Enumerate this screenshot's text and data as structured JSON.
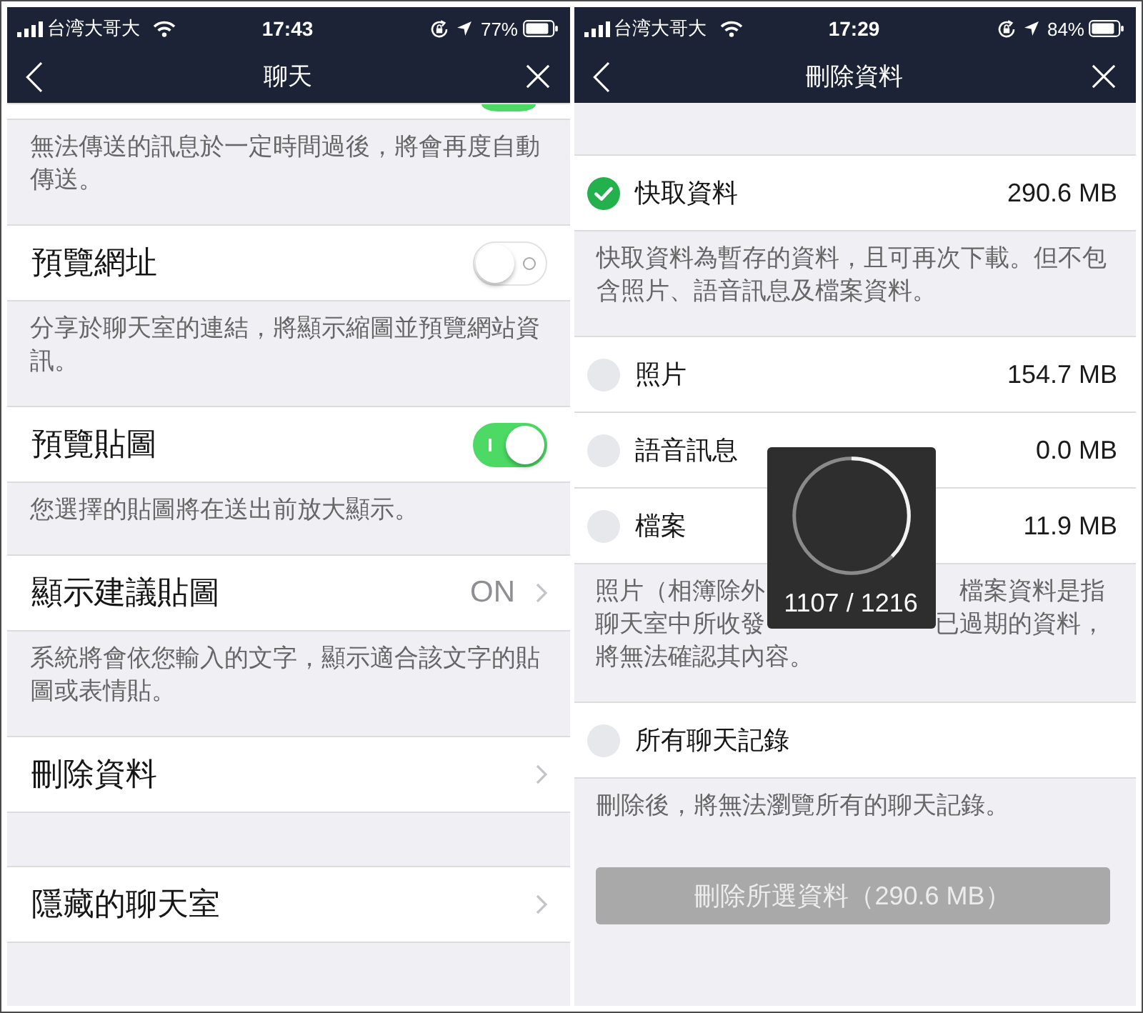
{
  "screens": [
    {
      "status_bar": {
        "carrier": "台湾大哥大",
        "time": "17:43",
        "battery": "77%"
      },
      "nav_bar": {
        "title": "聊天"
      },
      "sections": [
        {
          "clipped": true,
          "rows": [
            {
              "kind": "toggle",
              "on": true
            }
          ],
          "footer": "無法傳送的訊息於一定時間過後，將會再度自動傳送。"
        },
        {
          "rows": [
            {
              "kind": "toggle",
              "label": "預覽網址",
              "on": false
            }
          ],
          "footer": "分享於聊天室的連結，將顯示縮圖並預覽網站資訊。"
        },
        {
          "rows": [
            {
              "kind": "toggle",
              "label": "預覽貼圖",
              "on": true
            }
          ],
          "footer": "您選擇的貼圖將在送出前放大顯示。"
        },
        {
          "rows": [
            {
              "kind": "link",
              "label": "顯示建議貼圖",
              "value": "ON"
            }
          ],
          "footer": "系統將會依您輸入的文字，顯示適合該文字的貼圖或表情貼。"
        },
        {
          "rows": [
            {
              "kind": "link",
              "label": "刪除資料"
            }
          ]
        },
        {
          "rows": [
            {
              "kind": "link",
              "label": "隱藏的聊天室"
            }
          ]
        }
      ]
    },
    {
      "status_bar": {
        "carrier": "台湾大哥大",
        "time": "17:29",
        "battery": "84%"
      },
      "nav_bar": {
        "title": "刪除資料"
      },
      "sections": [
        {
          "rows": [
            {
              "kind": "check",
              "label": "快取資料",
              "checked": true,
              "value": "290.6 MB"
            }
          ],
          "footer": "快取資料為暫存的資料，且可再次下載。但不包含照片、語音訊息及檔案資料。"
        },
        {
          "rows": [
            {
              "kind": "check",
              "label": "照片",
              "checked": false,
              "value": "154.7 MB"
            },
            {
              "kind": "check",
              "label": "語音訊息",
              "checked": false,
              "value": "0.0 MB"
            },
            {
              "kind": "check",
              "label": "檔案",
              "checked": false,
              "value": "11.9 MB"
            }
          ],
          "footer_lines": [
            [
              "照片（相簿除外",
              "檔案資料是指"
            ],
            [
              "聊天室中所收發",
              "已過期的資料，"
            ],
            [
              "將無法確認其內容。"
            ]
          ]
        },
        {
          "rows": [
            {
              "kind": "check",
              "label": "所有聊天記錄",
              "checked": false
            }
          ],
          "footer": "刪除後，將無法瀏覽所有的聊天記錄。"
        }
      ],
      "button": {
        "label": "刪除所選資料（290.6 MB）",
        "disabled": true
      },
      "progress_hud": {
        "text": "1107 / 1216"
      }
    }
  ]
}
